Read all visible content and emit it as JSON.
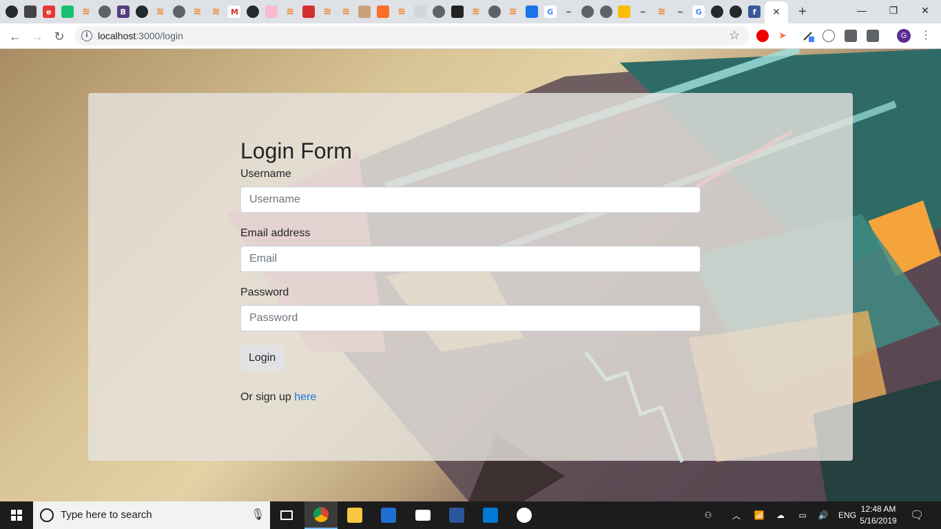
{
  "browser": {
    "tab_close_glyph": "✕",
    "new_tab_glyph": "+",
    "window_minimize_glyph": "—",
    "window_restore_glyph": "❐",
    "window_close_glyph": "✕",
    "url_host": "localhost",
    "url_path": ":3000/login",
    "profile_initial": "G"
  },
  "tab_icons": [
    "github-icon",
    "box-icon",
    "e-icon",
    "shield-icon",
    "stackoverflow-icon",
    "globe-icon",
    "bootstrap-icon",
    "github-icon",
    "stackoverflow-icon",
    "globe-icon",
    "stackoverflow-icon",
    "stackoverflow-icon",
    "gmail-icon",
    "github-icon",
    "pink-icon",
    "stackoverflow-icon",
    "red-square-icon",
    "stackoverflow-icon",
    "stackoverflow-icon",
    "cup-icon",
    "gitlab-icon",
    "stackoverflow-icon",
    "eye-icon",
    "globe-icon",
    "trello-icon",
    "stackoverflow-icon",
    "globe-icon",
    "stackoverflow-icon",
    "chat-icon",
    "google-icon",
    "tilde-icon",
    "globe-icon",
    "globe-icon",
    "drive-icon",
    "tilde-icon",
    "stackoverflow-icon",
    "tilde-icon",
    "google-icon",
    "github-icon",
    "github-icon",
    "facebook-icon"
  ],
  "form": {
    "title": "Login Form",
    "username_label": "Username",
    "username_placeholder": "Username",
    "email_label": "Email address",
    "email_placeholder": "Email",
    "password_label": "Password",
    "password_placeholder": "Password",
    "login_button": "Login",
    "signup_prefix": "Or sign up ",
    "signup_link": "here"
  },
  "taskbar": {
    "search_placeholder": "Type here to search",
    "language": "ENG",
    "time": "12:48 AM",
    "date": "5/16/2019"
  },
  "colors": {
    "link": "#1e73d8",
    "taskbar": "#1c1c1c",
    "card": "rgba(229,226,221,0.82)"
  }
}
